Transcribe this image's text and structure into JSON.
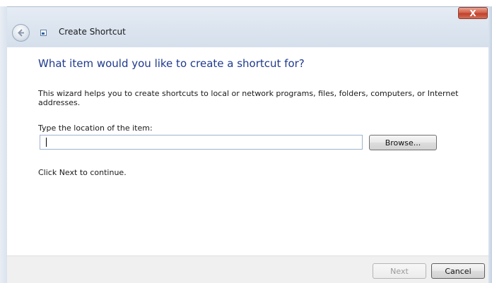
{
  "titlebar": {
    "close_symbol": "X",
    "back_icon": "back-arrow-icon",
    "wizard_icon": "shortcut-icon"
  },
  "wizard": {
    "title": "Create Shortcut",
    "heading": "What item would you like to create a shortcut for?",
    "description": "This wizard helps you to create shortcuts to local or network programs, files, folders, computers, or Internet addresses.",
    "location_label": "Type the location of the item:",
    "location_value": "",
    "browse_label": "Browse...",
    "hint": "Click Next to continue."
  },
  "footer": {
    "next_label": "Next",
    "cancel_label": "Cancel"
  },
  "colors": {
    "heading": "#1e3a8c",
    "close_button": "#c1412a",
    "footer_bg": "#f0f0f0"
  }
}
